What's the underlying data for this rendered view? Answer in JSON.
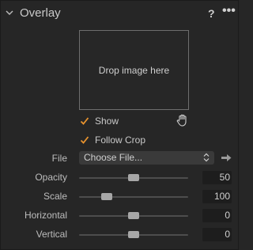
{
  "panel": {
    "title": "Overlay",
    "help_label": "?",
    "more_label": "•••",
    "icons": [
      "chevron-down-icon",
      "hand-icon",
      "updown-chevron-icon",
      "arrow-right-icon",
      "checkmark-icon"
    ]
  },
  "dropzone": {
    "text": "Drop image here"
  },
  "options": {
    "show": {
      "label": "Show",
      "checked": true
    },
    "follow_crop": {
      "label": "Follow Crop",
      "checked": true
    }
  },
  "file": {
    "label": "File",
    "value": "Choose File..."
  },
  "sliders": [
    {
      "label": "Opacity",
      "value": "50",
      "fraction": 0.5
    },
    {
      "label": "Scale",
      "value": "100",
      "fraction": 0.25
    },
    {
      "label": "Horizontal",
      "value": "0",
      "fraction": 0.5
    },
    {
      "label": "Vertical",
      "value": "0",
      "fraction": 0.5
    }
  ],
  "colors": {
    "accent_check": "#e8932e",
    "background": "#262626",
    "thumb": "#a7a7a7"
  }
}
